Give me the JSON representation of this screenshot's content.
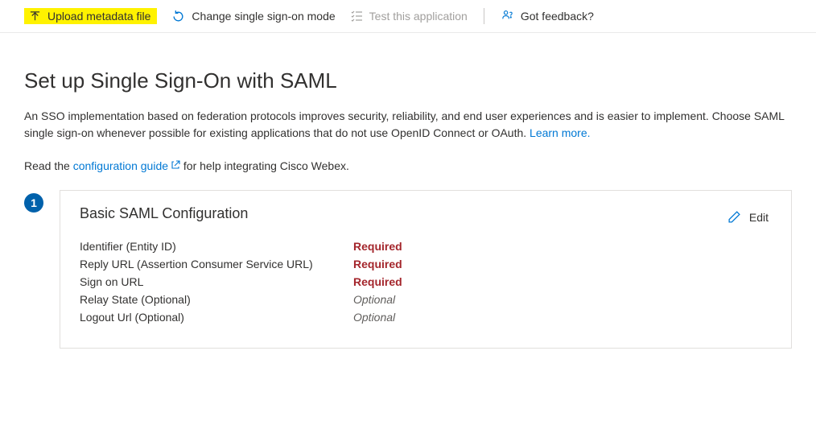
{
  "toolbar": {
    "upload_label": "Upload metadata file",
    "change_mode_label": "Change single sign-on mode",
    "test_app_label": "Test this application",
    "feedback_label": "Got feedback?"
  },
  "page": {
    "title": "Set up Single Sign-On with SAML",
    "description_pre": "An SSO implementation based on federation protocols improves security, reliability, and end user experiences and is easier to implement. Choose SAML single sign-on whenever possible for existing applications that do not use OpenID Connect or OAuth. ",
    "learn_more": "Learn more.",
    "guide_pre": "Read the ",
    "guide_link": "configuration guide",
    "guide_post": " for help integrating Cisco Webex."
  },
  "step": {
    "number": "1",
    "card_title": "Basic SAML Configuration",
    "edit_label": "Edit",
    "fields": [
      {
        "label": "Identifier (Entity ID)",
        "value": "Required",
        "kind": "required"
      },
      {
        "label": "Reply URL (Assertion Consumer Service URL)",
        "value": "Required",
        "kind": "required"
      },
      {
        "label": "Sign on URL",
        "value": "Required",
        "kind": "required"
      },
      {
        "label": "Relay State (Optional)",
        "value": "Optional",
        "kind": "optional"
      },
      {
        "label": "Logout Url (Optional)",
        "value": "Optional",
        "kind": "optional"
      }
    ]
  }
}
